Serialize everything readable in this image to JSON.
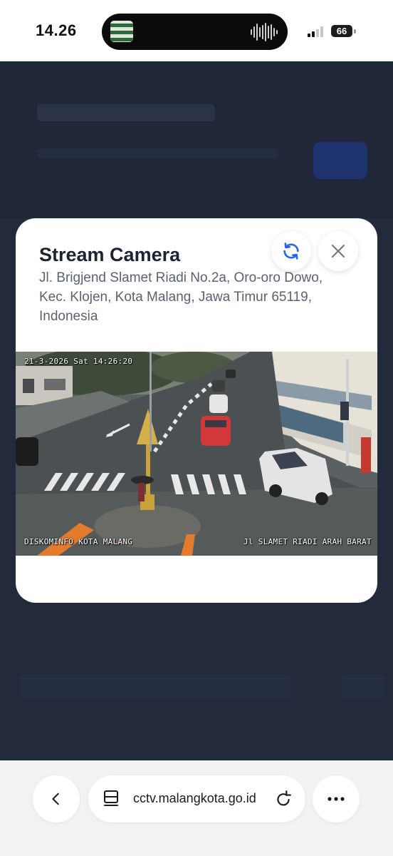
{
  "status_bar": {
    "time": "14.26",
    "battery": "66",
    "island_icons": [
      "app-thumbnail-icon",
      "audio-waveform-icon"
    ],
    "signal_icon": "cellular-signal-icon",
    "battery_icon": "battery-icon"
  },
  "modal": {
    "title": "Stream Camera",
    "address": "Jl. Brigjend Slamet Riadi No.2a, Oro-oro Dowo, Kec. Klojen, Kota Malang, Jawa Timur 65119, Indonesia",
    "refresh_icon": "refresh-icon",
    "close_icon": "close-icon",
    "accent_color": "#2563eb"
  },
  "camera": {
    "timestamp": "21-3-2026 Sat 14:26:20",
    "overlay_left": "DISKOMINFO KOTA MALANG",
    "overlay_right": "Jl SLAMET RIADI ARAH BARAT"
  },
  "browser": {
    "url": "cctv.malangkota.go.id",
    "back_icon": "chevron-left-icon",
    "reader_icon": "reader-mode-icon",
    "reload_icon": "reload-icon",
    "more_icon": "more-horizontal-icon"
  },
  "colors": {
    "overlay_background": "#1f2534",
    "modal_background": "#ffffff",
    "title_color": "#1c2433",
    "address_color": "#5b6270"
  }
}
